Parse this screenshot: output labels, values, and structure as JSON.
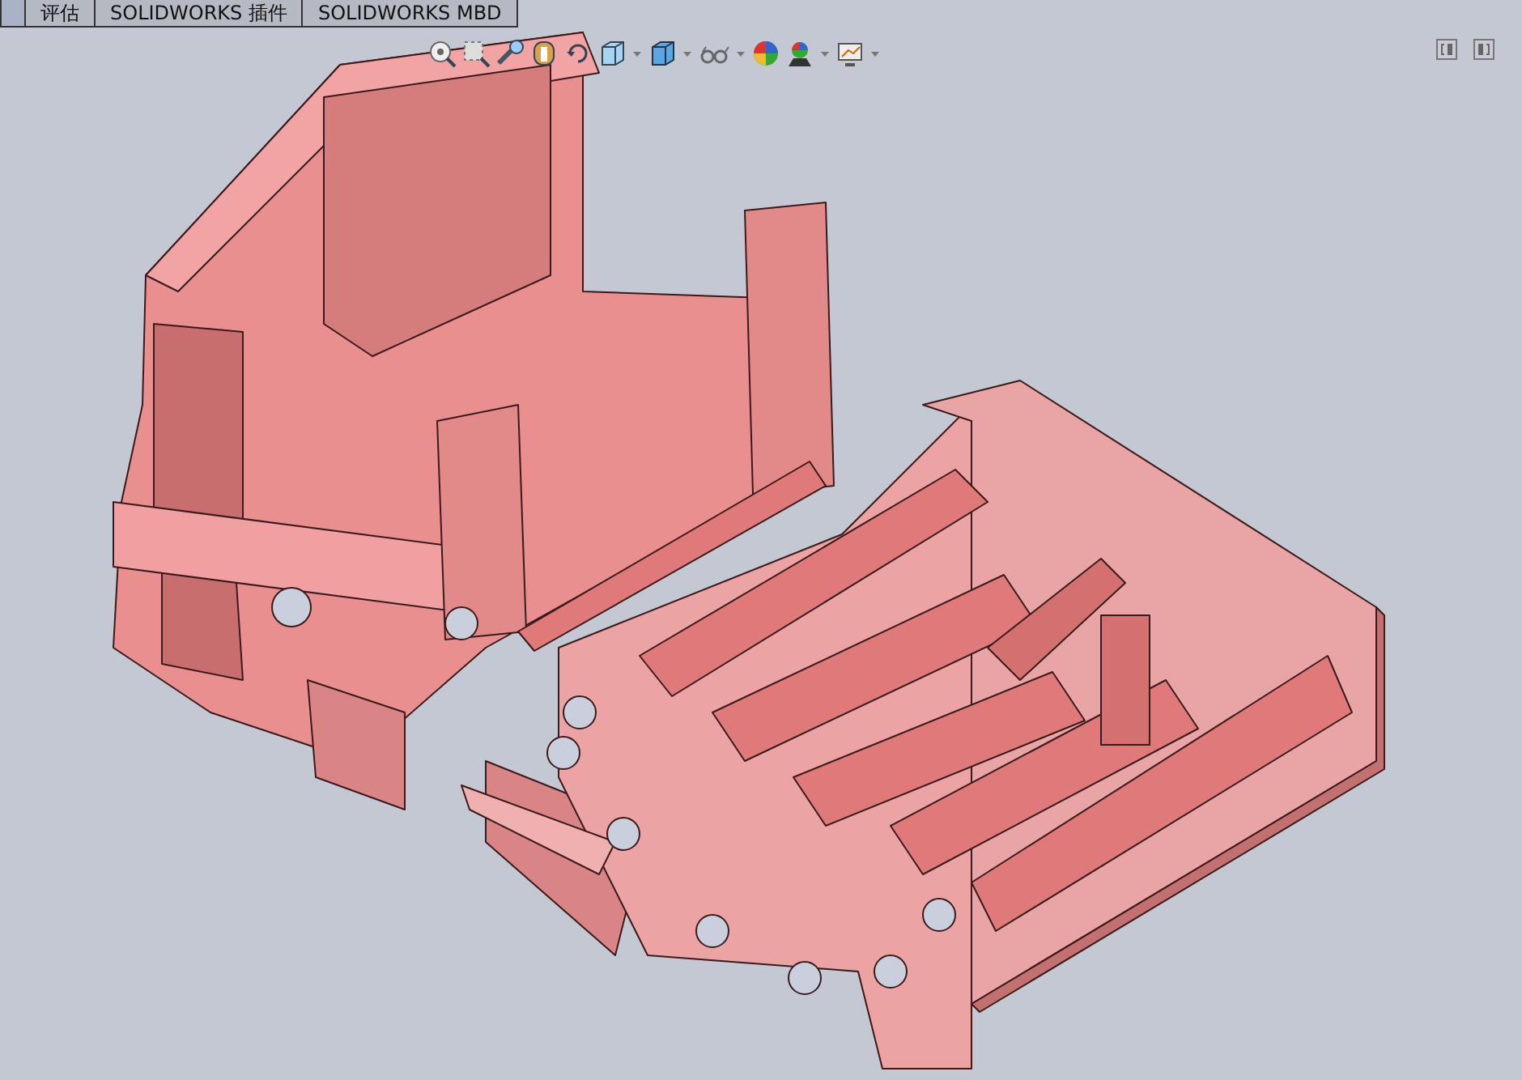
{
  "command_tabs": [
    {
      "label": "评估",
      "selected": false
    },
    {
      "label": "SOLIDWORKS 插件",
      "selected": false
    },
    {
      "label": "SOLIDWORKS MBD",
      "selected": false
    }
  ]
}
